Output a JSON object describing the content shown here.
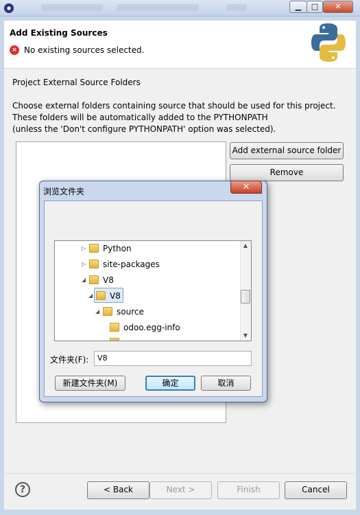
{
  "window": {
    "minimize_glyph": "▁",
    "maximize_glyph": "□",
    "close_glyph": "✕"
  },
  "header": {
    "title": "Add Existing Sources",
    "error_message": "No existing sources selected.",
    "error_icon_glyph": "×",
    "logo": "python-logo"
  },
  "body": {
    "section_label": "Project External Source Folders",
    "description_lines": [
      "Choose external folders containing source that should be used for this project.",
      "These folders will be automatically added to the PYTHONPATH",
      "(unless the 'Don't configure PYTHONPATH' option was selected)."
    ],
    "add_button": "Add external source folder",
    "remove_button": "Remove"
  },
  "footer": {
    "help_glyph": "?",
    "back_button": "< Back",
    "next_button": "Next >",
    "finish_button": "Finish",
    "cancel_button": "Cancel"
  },
  "browse_dialog": {
    "title": "浏览文件夹",
    "close_glyph": "✕",
    "tree": [
      {
        "label": "Python",
        "expanded": false,
        "selected": false
      },
      {
        "label": "site-packages",
        "expanded": false,
        "selected": false
      },
      {
        "label": "V8",
        "expanded": true,
        "selected": false
      },
      {
        "label": "V8",
        "expanded": true,
        "selected": true
      },
      {
        "label": "source",
        "expanded": true,
        "selected": false
      },
      {
        "label": "odoo.egg-info",
        "expanded": false,
        "selected": false
      }
    ],
    "folder_label": "文件夹(F):",
    "folder_value": "V8",
    "new_folder_button": "新建文件夹(M)",
    "ok_button": "确定",
    "cancel_button": "取消"
  },
  "colors": {
    "error": "#d9352b",
    "selection_bg": "#dcebfc",
    "folder": "#e4b53a"
  }
}
